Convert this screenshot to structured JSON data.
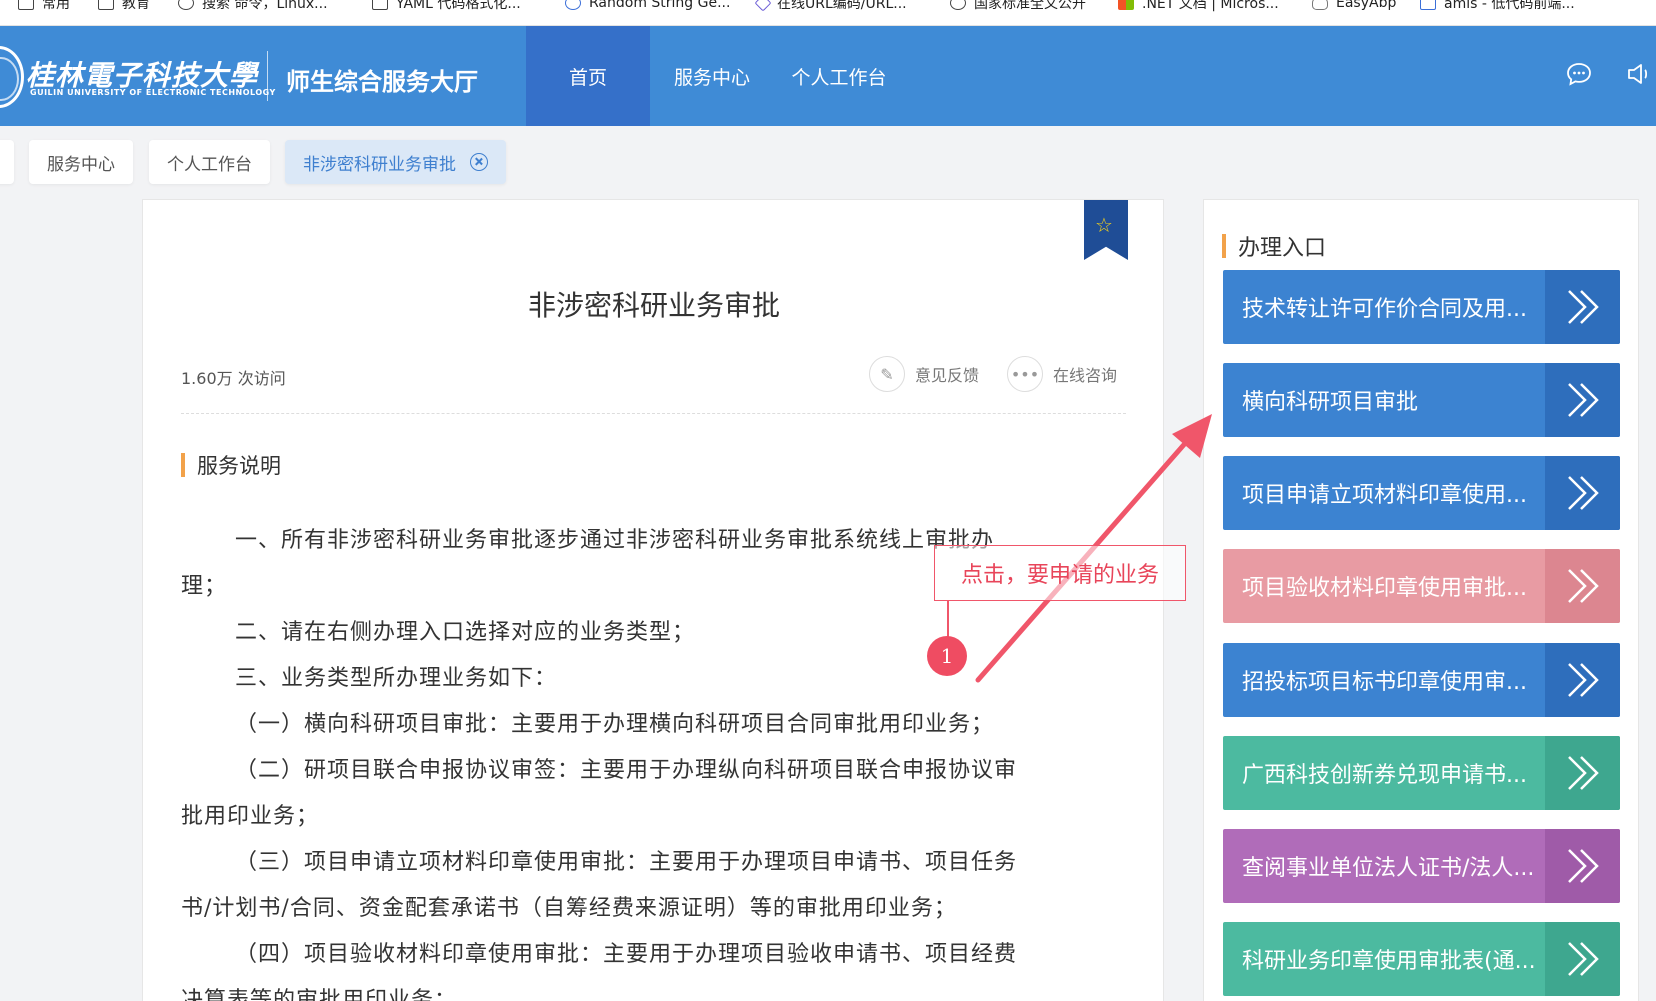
{
  "bookmarks": [
    {
      "label": "常用",
      "icon": "folder-icon"
    },
    {
      "label": "教育",
      "icon": "folder-icon"
    },
    {
      "label": "搜索 命令，Linux...",
      "icon": "linux-penguin-icon"
    },
    {
      "label": "YAML 代码格式化...",
      "icon": "tool-icon"
    },
    {
      "label": "Random String Ge...",
      "icon": "generator-icon"
    },
    {
      "label": "在线URL编码/URL...",
      "icon": "diamond-icon"
    },
    {
      "label": "国家标准全文公开",
      "icon": "globe-icon"
    },
    {
      "label": ".NET 文档 | Micros...",
      "icon": "windows-icon"
    },
    {
      "label": "EasyAbp",
      "icon": "easyabp-icon"
    },
    {
      "label": "amis - 低代码前端...",
      "icon": "amis-icon"
    }
  ],
  "header": {
    "logo_cn": "桂林電子科技大學",
    "logo_en": "GUILIN UNIVERSITY OF ELECTRONIC TECHNOLOGY",
    "site_title": "师生综合服务大厅",
    "nav": [
      {
        "label": "首页",
        "active": true
      },
      {
        "label": "服务中心",
        "active": false
      },
      {
        "label": "个人工作台",
        "active": false
      }
    ],
    "color": "#3f8bd6"
  },
  "tabs": [
    {
      "label": "服务中心",
      "active": false
    },
    {
      "label": "个人工作台",
      "active": false
    },
    {
      "label": "非涉密科研业务审批",
      "active": true
    }
  ],
  "main": {
    "title": "非涉密科研业务审批",
    "visits": "1.60万 次访问",
    "feedback_label": "意见反馈",
    "consult_label": "在线咨询",
    "section_title": "服务说明",
    "paragraphs": [
      "一、所有非涉密科研业务审批逐步通过非涉密科研业务审批系统线上审批办",
      "理；",
      "二、请在右侧办理入口选择对应的业务类型；",
      "三、业务类型所办理业务如下：",
      "（一）横向科研项目审批：主要用于办理横向科研项目合同审批用印业务；",
      "（二）研项目联合申报协议审签：主要用于办理纵向科研项目联合申报协议审",
      "批用印业务；",
      "（三）项目申请立项材料印章使用审批：主要用于办理项目申请书、项目任务",
      "书/计划书/合同、资金配套承诺书（自筹经费来源证明）等的审批用印业务；",
      "（四）项目验收材料印章使用审批：主要用于办理项目验收申请书、项目经费",
      "决算表等的审批用印业务；"
    ]
  },
  "side": {
    "title": "办理入口",
    "entries": [
      {
        "label": "技术转让许可作价合同及用...",
        "color": "blue"
      },
      {
        "label": "横向科研项目审批",
        "color": "blue"
      },
      {
        "label": "项目申请立项材料印章使用...",
        "color": "blue"
      },
      {
        "label": "项目验收材料印章使用审批...",
        "color": "pink"
      },
      {
        "label": "招投标项目标书印章使用审...",
        "color": "blue"
      },
      {
        "label": "广西科技创新券兑现申请书...",
        "color": "teal"
      },
      {
        "label": "查阅事业单位法人证书/法人...",
        "color": "purple"
      },
      {
        "label": "科研业务印章使用审批表(通...",
        "color": "teal"
      }
    ]
  },
  "annotation": {
    "callout_text": "点击，要申请的业务",
    "step_number": "1",
    "color": "#ef4c62"
  }
}
